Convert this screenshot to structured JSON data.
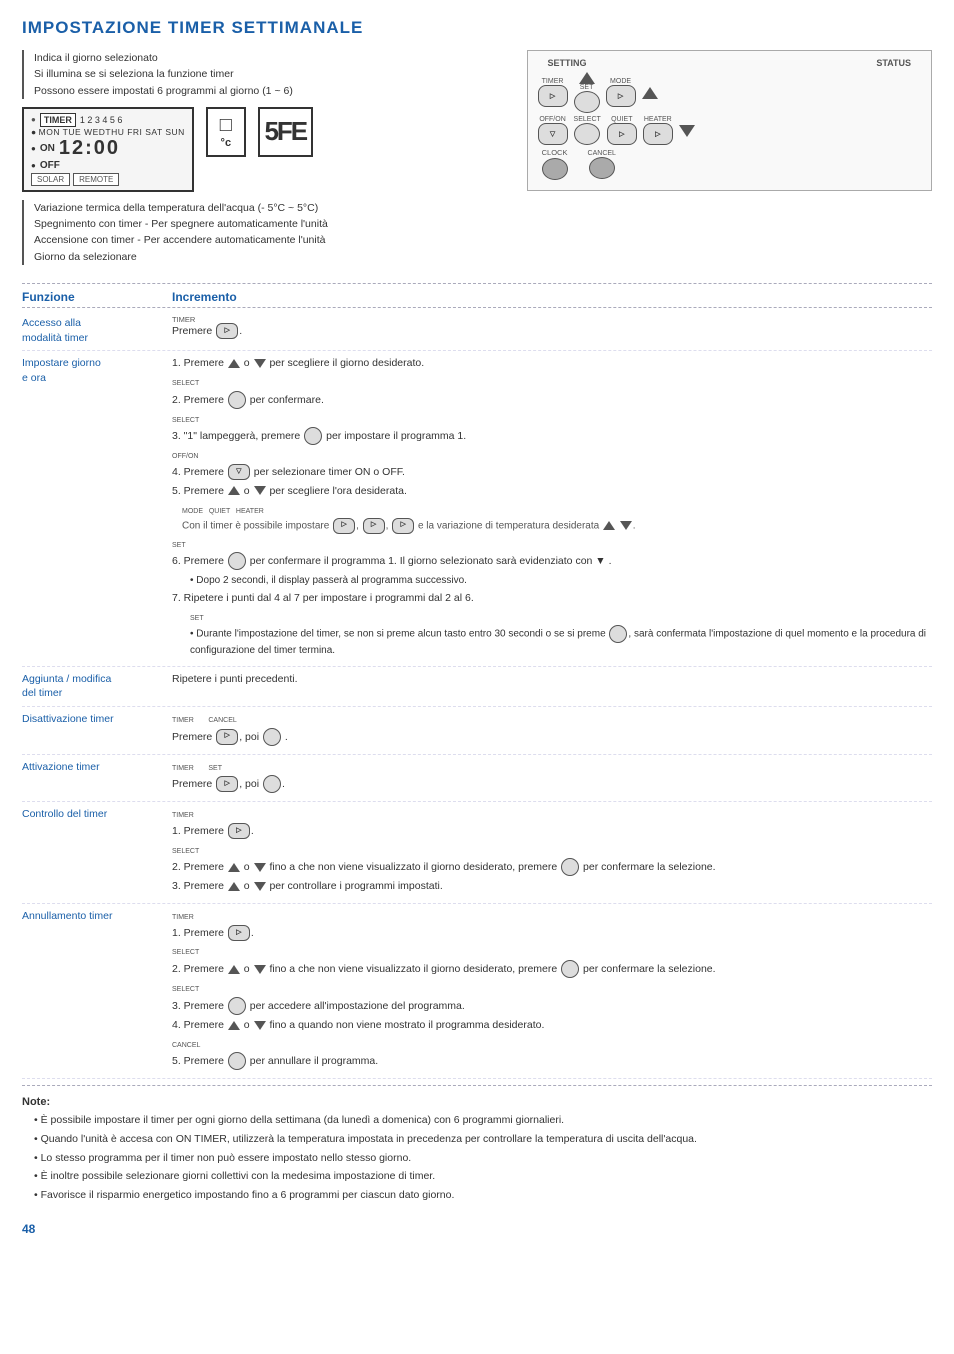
{
  "page": {
    "title": "IMPOSTAZIONE TIMER SETTIMANALE",
    "page_number": "48"
  },
  "diagram": {
    "annotation_lines": [
      "Indica il giorno selezionato",
      "Si illumina se si seleziona la funzione timer",
      "Possono essere impostati 6 programmi al giorno (1 ~ 6)"
    ],
    "timer_label": "TIMER",
    "days_label": "MON TUE WEDTHU FRI SAT SUN",
    "on_label": "ON",
    "off_label": "OFF",
    "clock_value": "12:00",
    "solar_label": "SOLAR",
    "remote_label": "REMOTE",
    "temp_label": "°c",
    "display_value": "5FE",
    "setting_label": "SETTING",
    "status_label": "STATUS",
    "timer_btn": "TIMER",
    "set_btn": "SET",
    "mode_btn": "MODE",
    "offon_btn": "OFF/ON",
    "select_btn": "SELECT",
    "quiet_btn": "QUIET",
    "heater_btn": "HEATER",
    "clock_btn": "CLOCK",
    "cancel_btn": "CANCEL"
  },
  "bottom_annotations": [
    "Variazione termica della temperatura dell'acqua (- 5°C ~ 5°C)",
    "Spegnimento con timer - Per spegnere automaticamente l'unità",
    "Accensione con timer - Per accendere automaticamente l'unità",
    "Giorno da selezionare"
  ],
  "table": {
    "col1_header": "Funzione",
    "col2_header": "Incremento",
    "rows": [
      {
        "funzione": "Accesso alla modalità timer",
        "steps": [
          {
            "text": "Premere [TIMER]."
          }
        ]
      },
      {
        "funzione": "Impostare giorno e ora",
        "steps": [
          {
            "num": "1.",
            "text": "Premere ▲ o ▼ per scegliere il giorno desiderato."
          },
          {
            "num": "2.",
            "text": "Premere [SELECT] per confermare."
          },
          {
            "num": "3.",
            "text": "\"1\" lampeggerà, premere [SELECT] per impostare il programma 1."
          },
          {
            "num": "4.",
            "text": "Premere [OFF/ON] per selezionare timer ON o OFF."
          },
          {
            "num": "5.",
            "text": "Premere ▲ o ▼ per scegliere l'ora desiderata."
          },
          {
            "indent": true,
            "text": "Con il timer è possibile impostare [MODE], [QUIET], [HEATER] e la variazione di temperatura desiderata ▲ ▼."
          },
          {
            "num": "6.",
            "text": "Premere [SET] per confermare il programma 1. Il giorno selezionato sarà evidenziato con ▼ ."
          },
          {
            "sub": "• Dopo 2 secondi, il display passerà al programma successivo."
          },
          {
            "num": "7.",
            "text": "Ripetere i punti dal 4 al 7 per impostare i programmi dal 2 al 6."
          },
          {
            "sub": "• Durante l'impostazione del timer, se non si preme alcun tasto entro 30 secondi o se si preme [SET], sarà confermata l'impostazione di quel momento e la procedura di configurazione del timer termina."
          }
        ]
      },
      {
        "funzione": "Aggiunta / modifica del timer",
        "steps": [
          {
            "text": "Ripetere i punti precedenti."
          }
        ]
      },
      {
        "funzione": "Disattivazione timer",
        "steps": [
          {
            "text": "Premere [TIMER], poi [CANCEL]."
          }
        ]
      },
      {
        "funzione": "Attivazione timer",
        "steps": [
          {
            "text": "Premere [TIMER], poi [SET]."
          }
        ]
      },
      {
        "funzione": "Controllo del timer",
        "steps": [
          {
            "num": "1.",
            "text": "Premere [TIMER]."
          },
          {
            "num": "2.",
            "text": "Premere ▲ o ▼ fino a che non viene visualizzato il giorno desiderato, premere [SELECT] per confermare la selezione."
          },
          {
            "num": "3.",
            "text": "Premere ▲ o ▼ per controllare i programmi impostati."
          }
        ]
      },
      {
        "funzione": "Annullamento timer",
        "steps": [
          {
            "num": "1.",
            "text": "Premere [TIMER]."
          },
          {
            "num": "2.",
            "text": "Premere ▲ o ▼ fino a che non viene visualizzato il giorno desiderato, premere [SELECT] per confermare la selezione."
          },
          {
            "num": "3.",
            "text": "Premere [SELECT] per accedere all'impostazione del programma."
          },
          {
            "num": "4.",
            "text": "Premere ▲ o ▼ fino a quando non viene mostrato il programma desiderato."
          },
          {
            "num": "5.",
            "text": "Premere [CANCEL] per annullare il programma."
          }
        ]
      }
    ]
  },
  "notes": {
    "title": "Note:",
    "items": [
      "È possibile impostare il timer per ogni giorno della settimana (da lunedì a domenica) con 6 programmi giornalieri.",
      "Quando l'unità è accesa con ON TIMER, utilizzerà la temperatura impostata in precedenza per controllare la temperatura di uscita dell'acqua.",
      "Lo stesso programma per il timer non può essere impostato nello stesso giorno.",
      "È inoltre possibile selezionare giorni collettivi con la medesima impostazione di timer.",
      "Favorisce il risparmio energetico impostando fino a 6 programmi per ciascun dato giorno."
    ]
  }
}
